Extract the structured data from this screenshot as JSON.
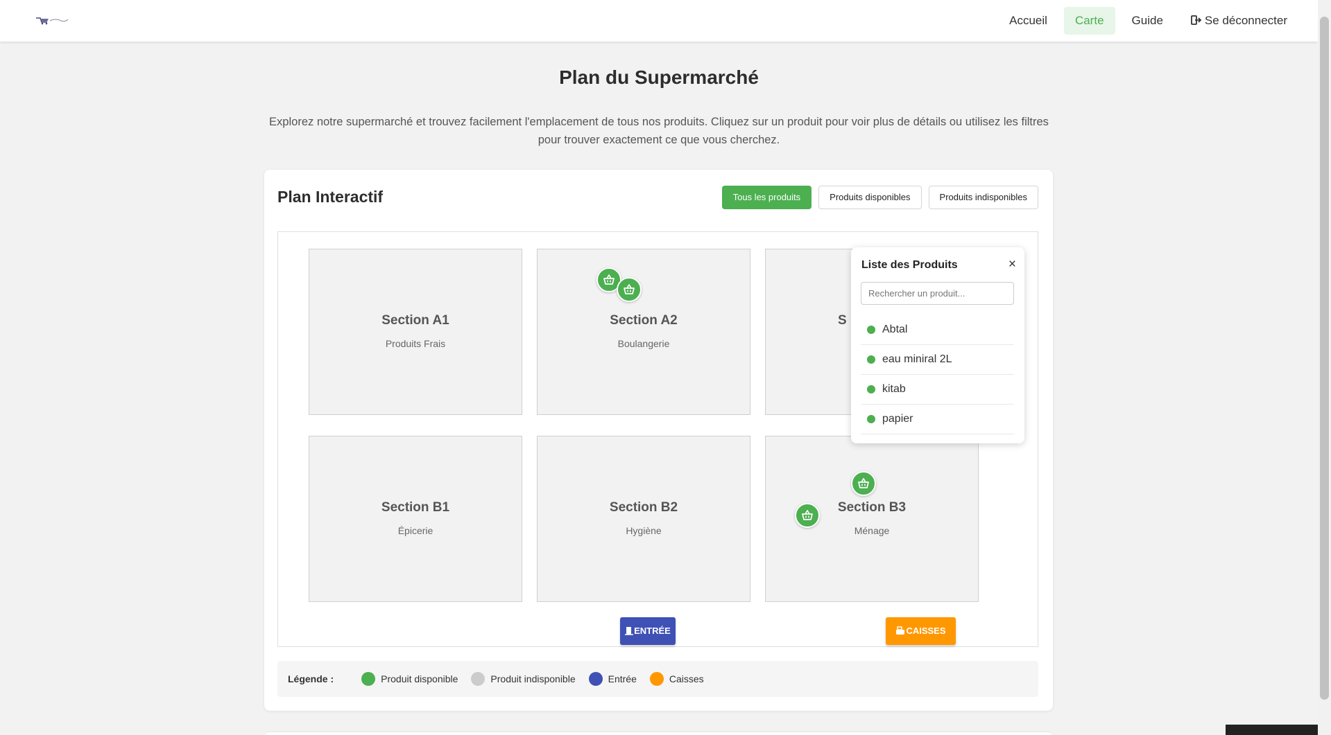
{
  "nav": {
    "items": [
      {
        "label": "Accueil"
      },
      {
        "label": "Carte"
      },
      {
        "label": "Guide"
      },
      {
        "label": "Se déconnecter",
        "icon": "logout-icon"
      }
    ],
    "active": "Carte"
  },
  "page": {
    "title": "Plan du Supermarché",
    "description": "Explorez notre supermarché et trouvez facilement l'emplacement de tous nos produits. Cliquez sur un produit pour voir plus de détails ou utilisez les filtres pour trouver exactement ce que vous cherchez."
  },
  "plan": {
    "title": "Plan Interactif",
    "filters": [
      "Tous les produits",
      "Produits disponibles",
      "Produits indisponibles"
    ],
    "active_filter": "Tous les produits",
    "sections": [
      {
        "name": "Section A1",
        "category": "Produits Frais"
      },
      {
        "name": "Section A2",
        "category": "Boulangerie"
      },
      {
        "name": "S",
        "category": ""
      },
      {
        "name": "Section B1",
        "category": "Épicerie"
      },
      {
        "name": "Section B2",
        "category": "Hygiène"
      },
      {
        "name": "Section B3",
        "category": "Ménage"
      }
    ],
    "entry_label": "ENTRÉE",
    "cash_label": "CAISSES"
  },
  "product_list": {
    "title": "Liste des Produits",
    "close": "×",
    "search_placeholder": "Rechercher un produit...",
    "items": [
      "Abtal",
      "eau miniral 2L",
      "kitab",
      "papier"
    ]
  },
  "legend": {
    "label": "Légende :",
    "items": [
      {
        "label": "Produit disponible",
        "color": "#4caf50"
      },
      {
        "label": "Produit indisponible",
        "color": "#cccccc"
      },
      {
        "label": "Entrée",
        "color": "#3f51b5"
      },
      {
        "label": "Caisses",
        "color": "#ff9800"
      }
    ]
  },
  "colors": {
    "accent": "#4caf50",
    "entry": "#3f51b5",
    "cash": "#ff9800"
  }
}
